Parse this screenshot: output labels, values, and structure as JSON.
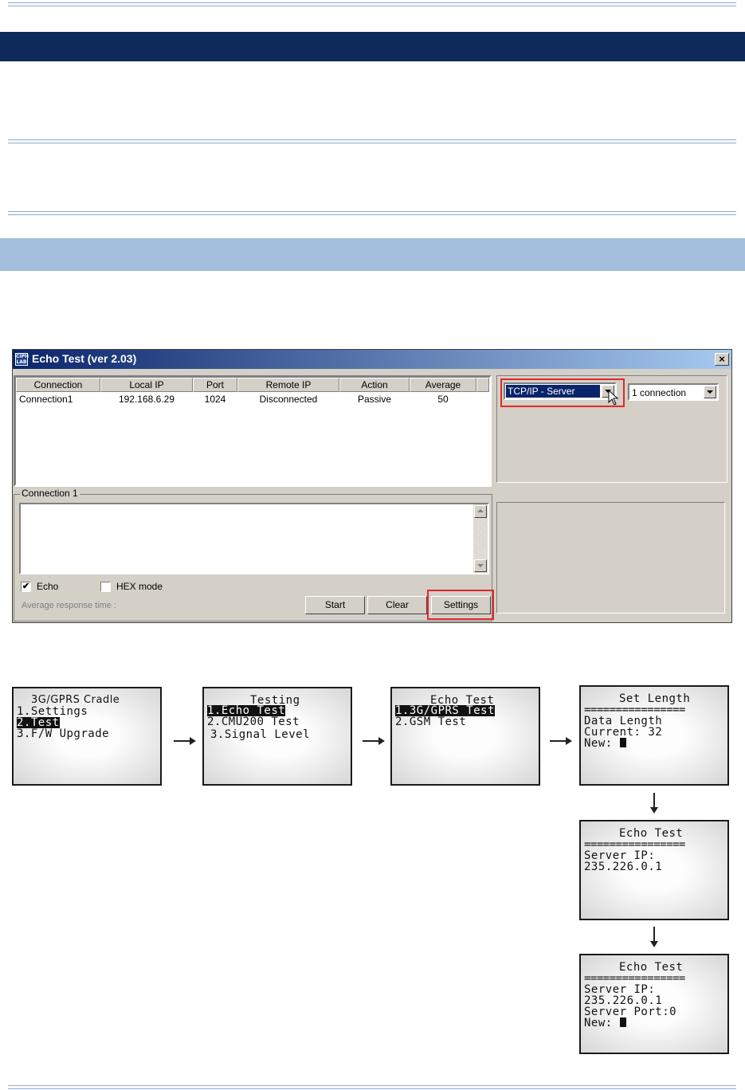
{
  "window": {
    "title": "Echo Test (ver 2.03)",
    "close_label": "×",
    "app_icon": "cipherlab-icon",
    "list": {
      "columns": [
        "Connection",
        "Local IP",
        "Port",
        "Remote IP",
        "Action",
        "Average"
      ],
      "rows": [
        [
          "Connection1",
          "192.168.6.29",
          "1024",
          "Disconnected",
          "Passive",
          "50"
        ]
      ]
    },
    "mode_select": {
      "value": "TCP/IP - Server"
    },
    "connections_select": {
      "value": "1 connection"
    },
    "group_label": "Connection 1",
    "echo_checkbox": {
      "label": "Echo",
      "checked": true
    },
    "hex_checkbox": {
      "label": "HEX mode",
      "checked": false
    },
    "avg_response_label": "Average response time :",
    "buttons": {
      "start": "Start",
      "clear": "Clear",
      "settings": "Settings"
    }
  },
  "lcd_screens": {
    "main_menu": {
      "title": "3G/GPRS Cradle",
      "items": [
        "1.Settings",
        "2.Test",
        "3.F/W Upgrade"
      ],
      "selected": "2.Test"
    },
    "testing": {
      "title": "Testing",
      "items": [
        "1.Echo Test",
        "2.CMU200 Test",
        "3.Signal Level"
      ],
      "selected": "1.Echo Test"
    },
    "echo_test_menu": {
      "title": "Echo Test",
      "items": [
        "1.3G/GPRS Test",
        "2.GSM Test"
      ],
      "selected": "1.3G/GPRS Test"
    },
    "set_length": {
      "title": "Set Length",
      "separator": "================",
      "lines": [
        "Data Length",
        "Current: 32",
        "New:"
      ]
    },
    "server_ip": {
      "title": "Echo Test",
      "separator": "================",
      "lines": [
        "Server IP:",
        "235.226.0.1"
      ]
    },
    "server_port": {
      "title": "Echo Test",
      "separator": "================",
      "lines": [
        "Server IP:",
        "235.226.0.1",
        "Server Port:0",
        "New:"
      ]
    }
  }
}
